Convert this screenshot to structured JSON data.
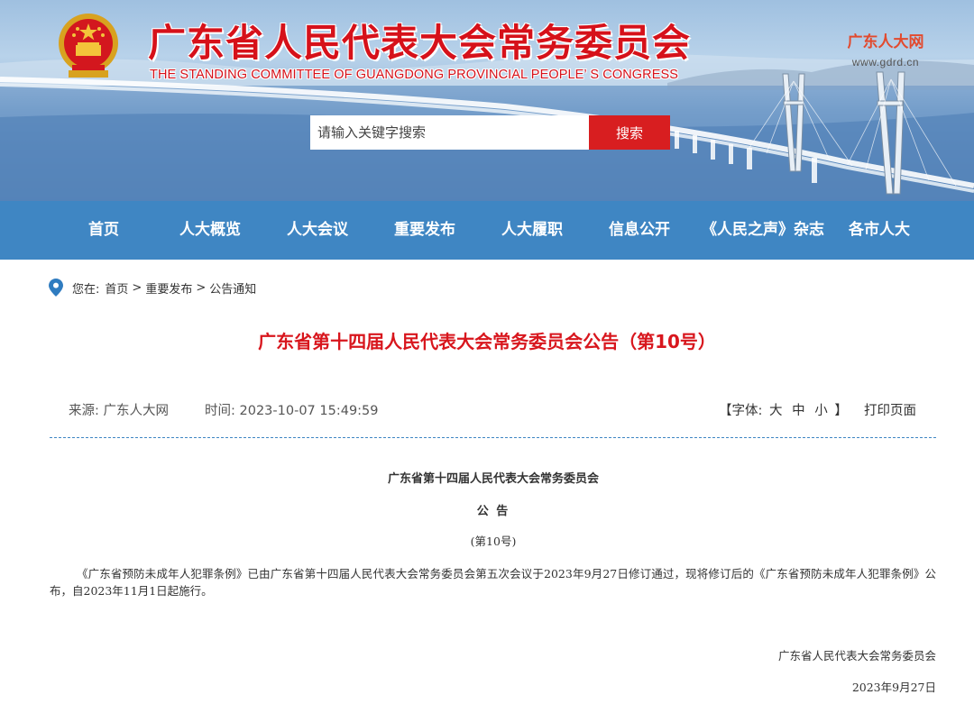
{
  "header": {
    "title": "广东省人民代表大会常务委员会",
    "subtitle": "THE STANDING COMMITTEE OF GUANGDONG PROVINCIAL PEOPLE’ S CONGRESS",
    "brand_name": "广东人大网",
    "brand_url": "www.gdrd.cn",
    "emblem_icon": "national-emblem-icon"
  },
  "search": {
    "placeholder": "请输入关键字搜索",
    "button_label": "搜索"
  },
  "nav": {
    "items": [
      "首页",
      "人大概览",
      "人大会议",
      "重要发布",
      "人大履职",
      "信息公开",
      "《人民之声》杂志",
      "各市人大"
    ]
  },
  "breadcrumb": {
    "prefix": "您在:",
    "items": [
      "首页",
      "重要发布",
      "公告通知"
    ],
    "separator": ">"
  },
  "article": {
    "title": "广东省第十四届人民代表大会常务委员会公告（第10号）",
    "source_label": "来源:",
    "source": "广东人大网",
    "time_label": "时间:",
    "time": "2023-10-07 15:49:59",
    "font_label_open": "【字体:",
    "font_sizes": [
      "大",
      "中",
      "小"
    ],
    "font_label_close": "】",
    "print_label": "打印页面"
  },
  "document": {
    "org": "广东省第十四届人民代表大会常务委员会",
    "kind": "公 告",
    "number": "(第10号)",
    "paragraph": "《广东省预防未成年人犯罪条例》已由广东省第十四届人民代表大会常务委员会第五次会议于2023年9月27日修订通过，现将修订后的《广东省预防未成年人犯罪条例》公布，自2023年11月1日起施行。",
    "sign_org": "广东省人民代表大会常务委员会",
    "sign_date": "2023年9月27日"
  },
  "colors": {
    "title_red": "#d6111a",
    "nav_blue": "#3f86c3",
    "search_red": "#d81e20",
    "article_title_red": "#d8161d"
  }
}
